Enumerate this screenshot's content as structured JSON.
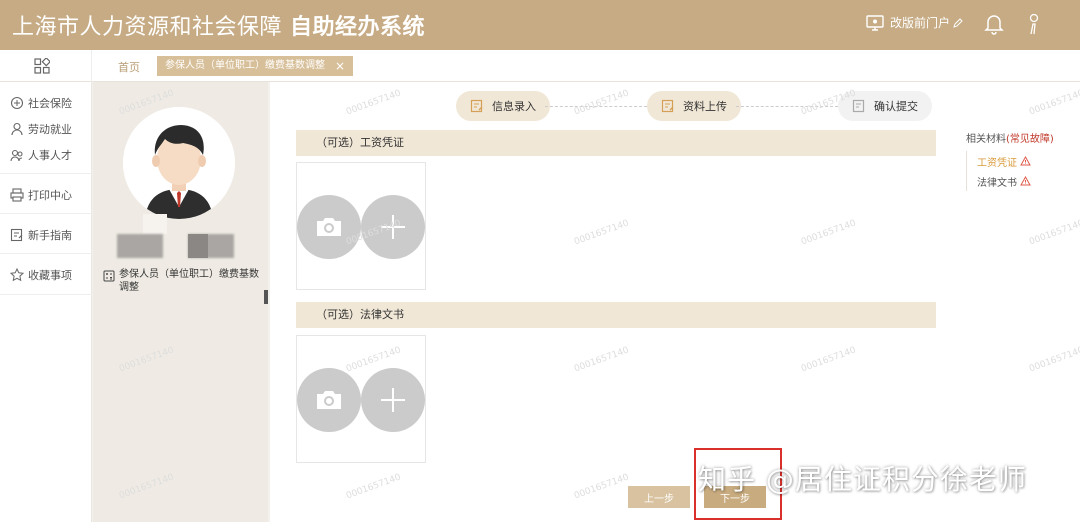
{
  "header": {
    "title_normal": "上海市人力资源和社会保障",
    "title_bold": "自助经办系统",
    "old_portal_label": "改版前门户",
    "icons": [
      "monitor-icon",
      "edit-icon",
      "bell-icon",
      "user-icon"
    ]
  },
  "tabbar": {
    "home_label": "首页",
    "active_tab_label": "参保人员（单位职工）缴费基数调整",
    "close_glyph": "×"
  },
  "leftnav": {
    "items": [
      {
        "label": "社会保险",
        "icon": "shield-icon"
      },
      {
        "label": "劳动就业",
        "icon": "person-icon"
      },
      {
        "label": "人事人才",
        "icon": "people-icon"
      },
      {
        "label": "打印中心",
        "icon": "printer-icon"
      },
      {
        "label": "新手指南",
        "icon": "guide-icon"
      },
      {
        "label": "收藏事项",
        "icon": "star-icon"
      }
    ]
  },
  "profile": {
    "function_label": "参保人员（单位职工）缴费基数调整"
  },
  "steps": [
    {
      "label": "信息录入",
      "state": "done"
    },
    {
      "label": "资料上传",
      "state": "current"
    },
    {
      "label": "确认提交",
      "state": "pending"
    }
  ],
  "sections": [
    {
      "title": "（可选）工资凭证"
    },
    {
      "title": "（可选）法律文书"
    }
  ],
  "related": {
    "label": "相关材料",
    "faq_link": "(常见故障)",
    "items": [
      {
        "label": "工资凭证",
        "active": true
      },
      {
        "label": "法律文书",
        "active": false
      }
    ]
  },
  "buttons": {
    "prev_label": "上一步",
    "next_label": "下一步"
  },
  "watermark_text": "0001657140",
  "overlay_text": "知乎 @居住证积分徐老师",
  "colors": {
    "header_bg": "#c6ab84",
    "accent": "#d7bf99",
    "highlight_border": "#d9302c"
  }
}
